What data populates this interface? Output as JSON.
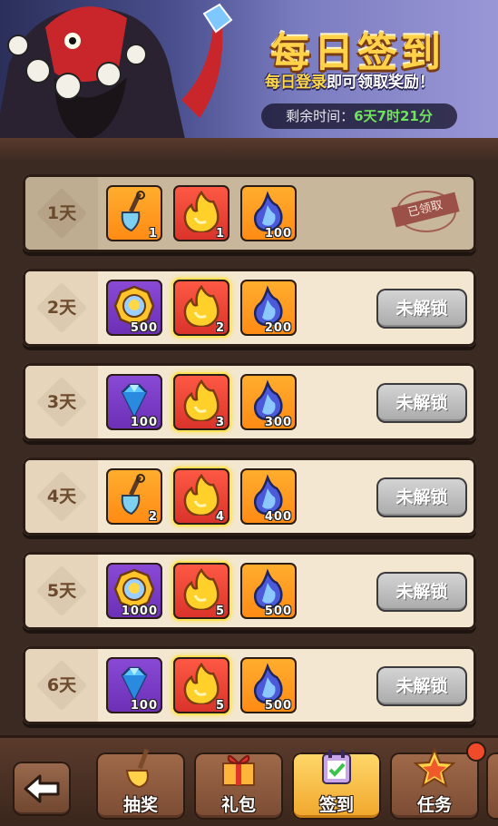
{
  "banner": {
    "title": "每日签到",
    "subtitle_highlight": "每日登录",
    "subtitle_rest": "即可领取奖励！",
    "timer_label": "剩余时间：",
    "timer_value": "6天7时21分"
  },
  "rows": [
    {
      "day": "1天",
      "status": "已领取",
      "items": [
        {
          "icon": "shovel-icon",
          "bg": "orange",
          "qty": "1"
        },
        {
          "icon": "gold-flame-icon",
          "bg": "red",
          "qty": "1"
        },
        {
          "icon": "blue-flame-icon",
          "bg": "orange",
          "qty": "100"
        }
      ]
    },
    {
      "day": "2天",
      "status": "未解锁",
      "items": [
        {
          "icon": "gold-medal-icon",
          "bg": "purple",
          "qty": "500"
        },
        {
          "icon": "gold-flame-icon",
          "bg": "red",
          "qty": "2"
        },
        {
          "icon": "blue-flame-icon",
          "bg": "orange",
          "qty": "200"
        }
      ]
    },
    {
      "day": "3天",
      "status": "未解锁",
      "items": [
        {
          "icon": "diamond-icon",
          "bg": "purple",
          "qty": "100"
        },
        {
          "icon": "gold-flame-icon",
          "bg": "red",
          "qty": "3"
        },
        {
          "icon": "blue-flame-icon",
          "bg": "orange",
          "qty": "300"
        }
      ]
    },
    {
      "day": "4天",
      "status": "未解锁",
      "items": [
        {
          "icon": "shovel-icon",
          "bg": "orange",
          "qty": "2"
        },
        {
          "icon": "gold-flame-icon",
          "bg": "red",
          "qty": "4"
        },
        {
          "icon": "blue-flame-icon",
          "bg": "orange",
          "qty": "400"
        }
      ]
    },
    {
      "day": "5天",
      "status": "未解锁",
      "items": [
        {
          "icon": "gold-medal-icon",
          "bg": "purple",
          "qty": "1000"
        },
        {
          "icon": "gold-flame-icon",
          "bg": "red",
          "qty": "5"
        },
        {
          "icon": "blue-flame-icon",
          "bg": "orange",
          "qty": "500"
        }
      ]
    },
    {
      "day": "6天",
      "status": "未解锁",
      "items": [
        {
          "icon": "diamond-icon",
          "bg": "purple",
          "qty": "100"
        },
        {
          "icon": "gold-flame-icon",
          "bg": "red",
          "qty": "5"
        },
        {
          "icon": "blue-flame-icon",
          "bg": "orange",
          "qty": "500"
        }
      ]
    }
  ],
  "nav": {
    "lottery": "抽奖",
    "gift": "礼包",
    "checkin": "签到",
    "task": "任务"
  },
  "colors": {
    "accent_gold": "#ffd24a",
    "timer_green": "#6ee45a",
    "locked_gray": "#a8a8a8"
  }
}
